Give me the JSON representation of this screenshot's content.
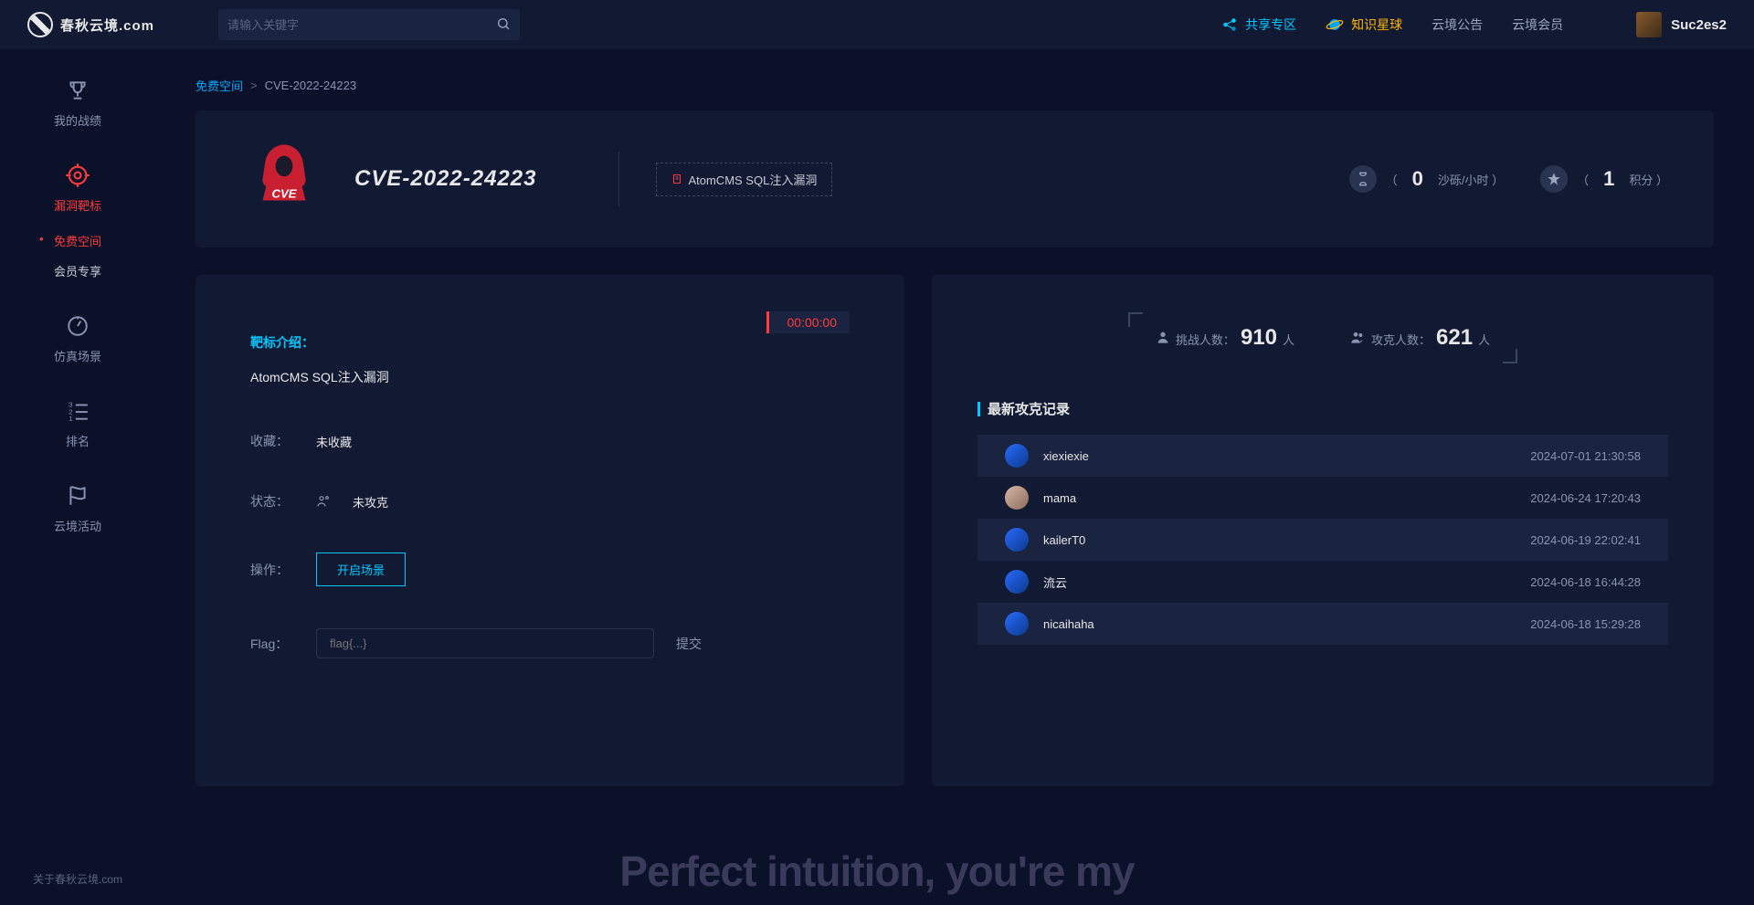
{
  "topbar": {
    "logo_text": "春秋云境.com",
    "search_placeholder": "请输入关键字",
    "links": {
      "share": "共享专区",
      "star": "知识星球",
      "notice": "云境公告",
      "member": "云境会员"
    },
    "username": "Suc2es2"
  },
  "sidebar": {
    "items": [
      {
        "label": "我的战绩"
      },
      {
        "label": "漏洞靶标"
      },
      {
        "label": "仿真场景"
      },
      {
        "label": "排名"
      },
      {
        "label": "云境活动"
      }
    ],
    "subs": {
      "free": "免费空间",
      "vip": "会员专享"
    },
    "footer": "关于春秋云境.com"
  },
  "breadcrumb": {
    "link": "免费空间",
    "sep": ">",
    "current": "CVE-2022-24223"
  },
  "header": {
    "title": "CVE-2022-24223",
    "tag": "AtomCMS SQL注入漏洞",
    "stat1_pre": "（",
    "stat1_num": "0",
    "stat1_suf": "沙砾/小时 ）",
    "stat2_pre": "（",
    "stat2_num": "1",
    "stat2_suf": "积分 ）"
  },
  "left": {
    "timer": "00:00:00",
    "intro_label": "靶标介绍：",
    "intro_text": "AtomCMS SQL注入漏洞",
    "fav_label": "收藏：",
    "fav_value": "未收藏",
    "status_label": "状态：",
    "status_value": "未攻克",
    "action_label": "操作：",
    "action_btn": "开启场景",
    "flag_label": "Flag：",
    "flag_placeholder": "flag{...}",
    "submit": "提交"
  },
  "right": {
    "challenge_label": "挑战人数：",
    "challenge_num": "910",
    "challenge_suf": "人",
    "conquer_label": "攻克人数：",
    "conquer_num": "621",
    "conquer_suf": "人",
    "section": "最新攻克记录",
    "records": [
      {
        "name": "xiexiexie",
        "time": "2024-07-01 21:30:58"
      },
      {
        "name": "mama",
        "time": "2024-06-24 17:20:43"
      },
      {
        "name": "kailerT0",
        "time": "2024-06-19 22:02:41"
      },
      {
        "name": "流云",
        "time": "2024-06-18 16:44:28"
      },
      {
        "name": "nicaihaha",
        "time": "2024-06-18 15:29:28"
      }
    ]
  },
  "floating": "Perfect intuition, you're my"
}
